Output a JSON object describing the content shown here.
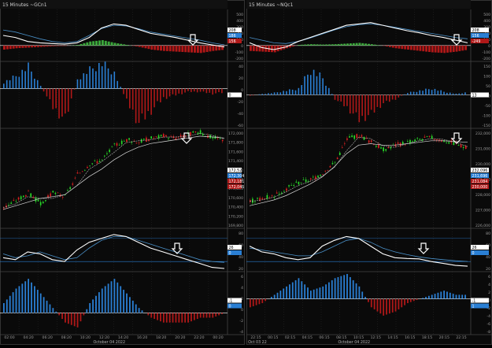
{
  "panels": [
    {
      "title": "15 Minutes ~GCn1",
      "x_ticks": [
        "02:00",
        "04:20",
        "06:20",
        "08:20",
        "10:20",
        "12:20",
        "14:20",
        "16:20",
        "18:20",
        "20:20",
        "22:20",
        "00:20"
      ],
      "date_label": "October 04 2022",
      "left_axis_label": "",
      "rsi_price": {
        "ticks": [
          "500",
          "400",
          "300",
          "200",
          "100",
          "0",
          "-100",
          "-200"
        ],
        "tags": [
          "208",
          "186",
          "156"
        ]
      },
      "momentum": {
        "ticks": [
          "40",
          "20",
          "0",
          "-20",
          "-40",
          "-60"
        ],
        "tags": [
          "0"
        ]
      },
      "price": {
        "ticks": [
          "172,000",
          "171,800",
          "171,600",
          "171,400",
          "171,200",
          "171,000",
          "170,800",
          "170,600",
          "170,400",
          "170,200",
          "169,800"
        ],
        "tags": [
          "172,527",
          "172,304",
          "172,181",
          "172,045"
        ]
      },
      "oscillator": {
        "ticks": [
          "80",
          "60",
          "40",
          "20"
        ],
        "tags": [
          "26",
          "0"
        ]
      },
      "histogram": {
        "ticks": [
          "6",
          "4",
          "2",
          "0",
          "-2",
          "-4"
        ],
        "tags": [
          "-1",
          "0"
        ]
      }
    },
    {
      "title": "15 Minutes ~NQc1",
      "x_ticks": [
        "22:15",
        "00:15",
        "02:15",
        "04:15",
        "06:15",
        "08:15",
        "10:15",
        "12:15",
        "14:15",
        "16:15",
        "18:15",
        "20:15",
        "22:15"
      ],
      "date_label": "October 04 2022",
      "left_axis_label": "Oct 03 22",
      "rsi_price": {
        "ticks": [
          "500",
          "400",
          "300",
          "200",
          "100",
          "0",
          "-100",
          "-200"
        ],
        "tags": [
          "208",
          "156",
          "-249"
        ]
      },
      "momentum": {
        "ticks": [
          "150",
          "100",
          "50",
          "0",
          "-50",
          "-100",
          "-150"
        ],
        "tags": [
          "13"
        ]
      },
      "price": {
        "ticks": [
          "232,000",
          "231,000",
          "230,000",
          "229,000",
          "228,000",
          "227,000",
          "226,000"
        ],
        "tags": [
          "232,096",
          "231,696",
          "231,084",
          "230,000"
        ]
      },
      "oscillator": {
        "ticks": [
          "80",
          "60",
          "40",
          "20"
        ],
        "tags": [
          "26",
          "0"
        ]
      },
      "histogram": {
        "ticks": [
          "6",
          "4",
          "2",
          "0",
          "-2",
          "-4",
          "-6",
          "-8"
        ],
        "tags": [
          "-1",
          "1"
        ]
      }
    }
  ],
  "colors": {
    "background": "#0a0a0a",
    "grid": "#2a2a2a",
    "white_line": "#ffffff",
    "blue_line": "#4a90c8",
    "green": "#3aa63a",
    "red": "#b01818",
    "blue_bar": "#2a7fd4",
    "up_candle": "#28d828",
    "down_candle": "#d82020"
  },
  "chart_data": [
    {
      "type": "line",
      "title": "15 Minutes ~GCn1",
      "panes": [
        {
          "name": "macd",
          "ylim": [
            -200,
            500
          ],
          "series": [
            {
              "values": [
                150,
                120,
                60,
                40,
                30,
                20,
                40,
                120,
                260,
                320,
                300,
                240,
                180,
                150,
                120,
                80,
                40,
                10,
                -20
              ]
            },
            {
              "values": [
                230,
                200,
                150,
                100,
                60,
                40,
                60,
                150,
                250,
                300,
                290,
                250,
                200,
                170,
                140,
                110,
                80,
                40,
                10
              ]
            },
            {
              "values": [
                -60,
                -40,
                -30,
                -20,
                -10,
                -5,
                10,
                60,
                80,
                40,
                10,
                -20,
                -60,
                -80,
                -90,
                -100,
                -110,
                -80,
                -60
              ]
            }
          ]
        },
        {
          "name": "momentum",
          "ylim": [
            -60,
            40
          ],
          "series": [
            {
              "values": [
                10,
                20,
                35,
                5,
                -30,
                -50,
                15,
                30,
                40,
                25,
                -20,
                -55,
                -35,
                -15,
                -10,
                -5,
                -5,
                -8,
                -6
              ]
            }
          ]
        },
        {
          "name": "price",
          "ylim": [
            169800,
            172400
          ],
          "series": [
            {
              "values": [
                170300,
                170500,
                170700,
                170400,
                170700,
                170600,
                171200,
                171500,
                171600,
                172000,
                172150,
                172100,
                172200,
                172250,
                172200,
                172300,
                172350,
                172200,
                172150
              ]
            },
            {
              "values": [
                170250,
                170350,
                170450,
                170550,
                170600,
                170650,
                170900,
                171150,
                171350,
                171600,
                171800,
                171950,
                172050,
                172100,
                172150,
                172200,
                172250,
                172230,
                172200
              ]
            }
          ]
        },
        {
          "name": "oscillator",
          "ylim": [
            0,
            100
          ],
          "series": [
            {
              "values": [
                30,
                25,
                45,
                40,
                25,
                20,
                50,
                70,
                80,
                90,
                85,
                70,
                55,
                45,
                35,
                25,
                15,
                5,
                2
              ]
            },
            {
              "values": [
                40,
                30,
                35,
                45,
                35,
                25,
                30,
                55,
                75,
                85,
                85,
                75,
                65,
                55,
                45,
                35,
                25,
                20,
                18
              ]
            }
          ]
        },
        {
          "name": "histogram",
          "ylim": [
            -4,
            8
          ],
          "series": [
            {
              "values": [
                2,
                5,
                7,
                4,
                1,
                -2,
                -3,
                2,
                5,
                7,
                4,
                1,
                -1,
                -2,
                -2,
                -2,
                -1,
                -1,
                0
              ]
            }
          ]
        }
      ]
    },
    {
      "type": "line",
      "title": "15 Minutes ~NQc1",
      "panes": [
        {
          "name": "macd",
          "ylim": [
            -200,
            500
          ],
          "series": [
            {
              "values": [
                40,
                -30,
                -60,
                -20,
                60,
                120,
                180,
                240,
                300,
                320,
                340,
                300,
                260,
                220,
                190,
                150,
                120,
                80,
                40
              ]
            },
            {
              "values": [
                120,
                80,
                40,
                30,
                60,
                110,
                170,
                230,
                280,
                310,
                320,
                300,
                270,
                240,
                210,
                180,
                150,
                120,
                100
              ]
            },
            {
              "values": [
                -80,
                -90,
                -100,
                -40,
                10,
                20,
                15,
                20,
                30,
                40,
                20,
                -5,
                -40,
                -60,
                -80,
                -100,
                -110,
                -90,
                -60
              ]
            }
          ]
        },
        {
          "name": "momentum",
          "ylim": [
            -150,
            150
          ],
          "series": [
            {
              "values": [
                -5,
                5,
                10,
                20,
                30,
                120,
                80,
                -20,
                -60,
                -120,
                -90,
                -40,
                -20,
                10,
                20,
                30,
                15,
                5,
                13
              ]
            }
          ]
        },
        {
          "name": "price",
          "ylim": [
            225800,
            232400
          ],
          "series": [
            {
              "values": [
                227500,
                227700,
                227900,
                228400,
                228800,
                229000,
                229500,
                230200,
                231800,
                232100,
                231600,
                231100,
                231400,
                231600,
                231800,
                231900,
                231700,
                231500,
                231100
              ]
            },
            {
              "values": [
                227200,
                227400,
                227600,
                227900,
                228300,
                228700,
                229200,
                229900,
                230800,
                231400,
                231500,
                231400,
                231400,
                231500,
                231600,
                231700,
                231700,
                231650,
                231600
              ]
            }
          ]
        },
        {
          "name": "oscillator",
          "ylim": [
            0,
            100
          ],
          "series": [
            {
              "values": [
                60,
                45,
                40,
                30,
                25,
                30,
                60,
                75,
                85,
                80,
                60,
                40,
                30,
                28,
                27,
                20,
                15,
                10,
                8
              ]
            },
            {
              "values": [
                55,
                50,
                45,
                40,
                35,
                35,
                45,
                60,
                75,
                80,
                70,
                55,
                45,
                38,
                32,
                28,
                25,
                22,
                20
              ]
            }
          ]
        },
        {
          "name": "histogram",
          "ylim": [
            -8,
            6
          ],
          "series": [
            {
              "values": [
                -2,
                -1,
                1,
                3,
                5,
                2,
                3,
                5,
                6,
                3,
                -2,
                -4,
                -3,
                -1,
                0,
                1,
                2,
                1,
                1
              ]
            }
          ]
        }
      ]
    }
  ]
}
